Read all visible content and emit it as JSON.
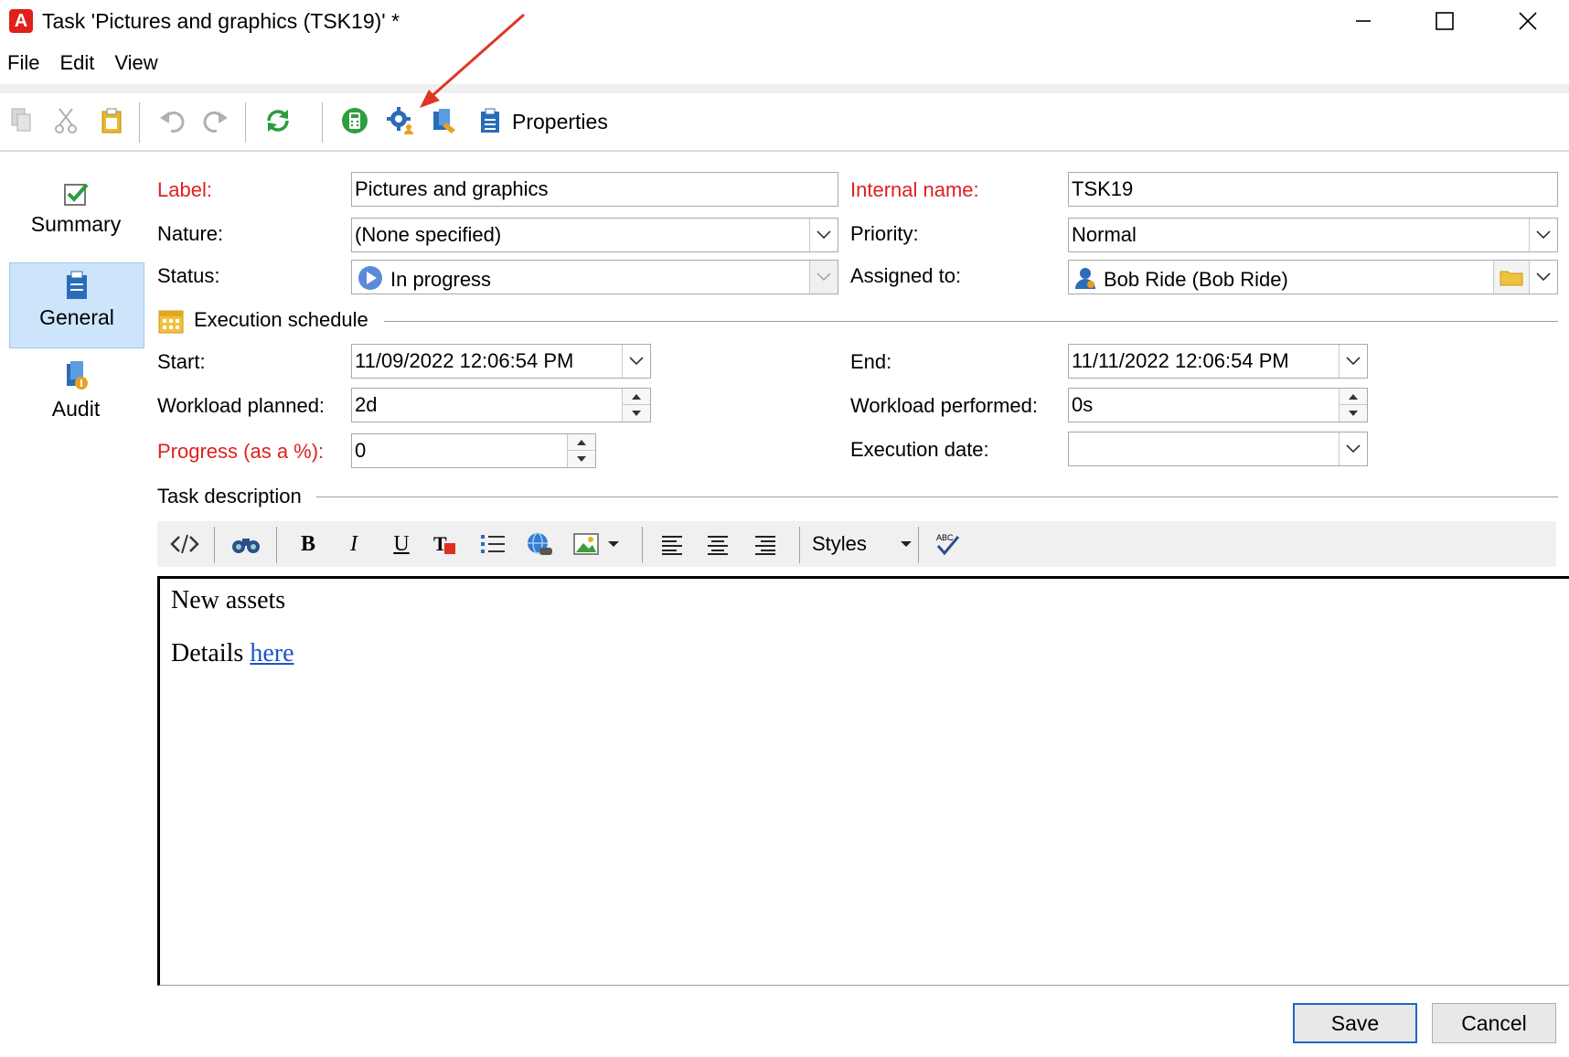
{
  "window": {
    "title": "Task 'Pictures and graphics (TSK19)' *",
    "app_logo_letter": "A"
  },
  "menu": [
    "File",
    "Edit",
    "View"
  ],
  "toolbar": {
    "properties_label": "Properties"
  },
  "sidebar": {
    "items": [
      {
        "label": "Summary",
        "icon": "checkbox-icon"
      },
      {
        "label": "General",
        "icon": "clipboard-icon",
        "active": true
      },
      {
        "label": "Audit",
        "icon": "audit-icon"
      }
    ]
  },
  "form": {
    "label": {
      "label": "Label:",
      "value": "Pictures and graphics"
    },
    "internal_name": {
      "label": "Internal name:",
      "value": "TSK19"
    },
    "nature": {
      "label": "Nature:",
      "value": "(None specified)"
    },
    "priority": {
      "label": "Priority:",
      "value": "Normal"
    },
    "status": {
      "label": "Status:",
      "value": "In progress"
    },
    "assigned_to": {
      "label": "Assigned to:",
      "value": "Bob Ride (Bob Ride)"
    }
  },
  "schedule": {
    "section_title": "Execution schedule",
    "start": {
      "label": "Start:",
      "value": "11/09/2022 12:06:54 PM"
    },
    "end": {
      "label": "End:",
      "value": "11/11/2022 12:06:54 PM"
    },
    "workload_planned": {
      "label": "Workload planned:",
      "value": "2d"
    },
    "workload_performed": {
      "label": "Workload performed:",
      "value": "0s"
    },
    "progress": {
      "label": "Progress (as a %):",
      "value": "0"
    },
    "execution_date": {
      "label": "Execution date:",
      "value": ""
    }
  },
  "description": {
    "section_title": "Task description",
    "styles_label": "Styles",
    "line1": "New assets",
    "line2_text": "Details",
    "line2_link": "here"
  },
  "buttons": {
    "save": "Save",
    "cancel": "Cancel"
  },
  "colors": {
    "required_label": "#e02020",
    "accent_blue": "#1a66c8",
    "active_tab_bg": "#cde5fb"
  }
}
